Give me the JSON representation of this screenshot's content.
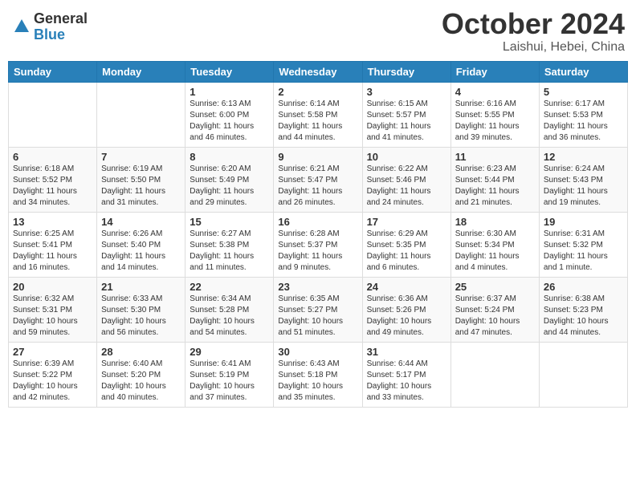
{
  "header": {
    "logo_general": "General",
    "logo_blue": "Blue",
    "month_title": "October 2024",
    "subtitle": "Laishui, Hebei, China"
  },
  "days_of_week": [
    "Sunday",
    "Monday",
    "Tuesday",
    "Wednesday",
    "Thursday",
    "Friday",
    "Saturday"
  ],
  "weeks": [
    [
      {
        "day": "",
        "info": ""
      },
      {
        "day": "",
        "info": ""
      },
      {
        "day": "1",
        "info": "Sunrise: 6:13 AM\nSunset: 6:00 PM\nDaylight: 11 hours and 46 minutes."
      },
      {
        "day": "2",
        "info": "Sunrise: 6:14 AM\nSunset: 5:58 PM\nDaylight: 11 hours and 44 minutes."
      },
      {
        "day": "3",
        "info": "Sunrise: 6:15 AM\nSunset: 5:57 PM\nDaylight: 11 hours and 41 minutes."
      },
      {
        "day": "4",
        "info": "Sunrise: 6:16 AM\nSunset: 5:55 PM\nDaylight: 11 hours and 39 minutes."
      },
      {
        "day": "5",
        "info": "Sunrise: 6:17 AM\nSunset: 5:53 PM\nDaylight: 11 hours and 36 minutes."
      }
    ],
    [
      {
        "day": "6",
        "info": "Sunrise: 6:18 AM\nSunset: 5:52 PM\nDaylight: 11 hours and 34 minutes."
      },
      {
        "day": "7",
        "info": "Sunrise: 6:19 AM\nSunset: 5:50 PM\nDaylight: 11 hours and 31 minutes."
      },
      {
        "day": "8",
        "info": "Sunrise: 6:20 AM\nSunset: 5:49 PM\nDaylight: 11 hours and 29 minutes."
      },
      {
        "day": "9",
        "info": "Sunrise: 6:21 AM\nSunset: 5:47 PM\nDaylight: 11 hours and 26 minutes."
      },
      {
        "day": "10",
        "info": "Sunrise: 6:22 AM\nSunset: 5:46 PM\nDaylight: 11 hours and 24 minutes."
      },
      {
        "day": "11",
        "info": "Sunrise: 6:23 AM\nSunset: 5:44 PM\nDaylight: 11 hours and 21 minutes."
      },
      {
        "day": "12",
        "info": "Sunrise: 6:24 AM\nSunset: 5:43 PM\nDaylight: 11 hours and 19 minutes."
      }
    ],
    [
      {
        "day": "13",
        "info": "Sunrise: 6:25 AM\nSunset: 5:41 PM\nDaylight: 11 hours and 16 minutes."
      },
      {
        "day": "14",
        "info": "Sunrise: 6:26 AM\nSunset: 5:40 PM\nDaylight: 11 hours and 14 minutes."
      },
      {
        "day": "15",
        "info": "Sunrise: 6:27 AM\nSunset: 5:38 PM\nDaylight: 11 hours and 11 minutes."
      },
      {
        "day": "16",
        "info": "Sunrise: 6:28 AM\nSunset: 5:37 PM\nDaylight: 11 hours and 9 minutes."
      },
      {
        "day": "17",
        "info": "Sunrise: 6:29 AM\nSunset: 5:35 PM\nDaylight: 11 hours and 6 minutes."
      },
      {
        "day": "18",
        "info": "Sunrise: 6:30 AM\nSunset: 5:34 PM\nDaylight: 11 hours and 4 minutes."
      },
      {
        "day": "19",
        "info": "Sunrise: 6:31 AM\nSunset: 5:32 PM\nDaylight: 11 hours and 1 minute."
      }
    ],
    [
      {
        "day": "20",
        "info": "Sunrise: 6:32 AM\nSunset: 5:31 PM\nDaylight: 10 hours and 59 minutes."
      },
      {
        "day": "21",
        "info": "Sunrise: 6:33 AM\nSunset: 5:30 PM\nDaylight: 10 hours and 56 minutes."
      },
      {
        "day": "22",
        "info": "Sunrise: 6:34 AM\nSunset: 5:28 PM\nDaylight: 10 hours and 54 minutes."
      },
      {
        "day": "23",
        "info": "Sunrise: 6:35 AM\nSunset: 5:27 PM\nDaylight: 10 hours and 51 minutes."
      },
      {
        "day": "24",
        "info": "Sunrise: 6:36 AM\nSunset: 5:26 PM\nDaylight: 10 hours and 49 minutes."
      },
      {
        "day": "25",
        "info": "Sunrise: 6:37 AM\nSunset: 5:24 PM\nDaylight: 10 hours and 47 minutes."
      },
      {
        "day": "26",
        "info": "Sunrise: 6:38 AM\nSunset: 5:23 PM\nDaylight: 10 hours and 44 minutes."
      }
    ],
    [
      {
        "day": "27",
        "info": "Sunrise: 6:39 AM\nSunset: 5:22 PM\nDaylight: 10 hours and 42 minutes."
      },
      {
        "day": "28",
        "info": "Sunrise: 6:40 AM\nSunset: 5:20 PM\nDaylight: 10 hours and 40 minutes."
      },
      {
        "day": "29",
        "info": "Sunrise: 6:41 AM\nSunset: 5:19 PM\nDaylight: 10 hours and 37 minutes."
      },
      {
        "day": "30",
        "info": "Sunrise: 6:43 AM\nSunset: 5:18 PM\nDaylight: 10 hours and 35 minutes."
      },
      {
        "day": "31",
        "info": "Sunrise: 6:44 AM\nSunset: 5:17 PM\nDaylight: 10 hours and 33 minutes."
      },
      {
        "day": "",
        "info": ""
      },
      {
        "day": "",
        "info": ""
      }
    ]
  ]
}
